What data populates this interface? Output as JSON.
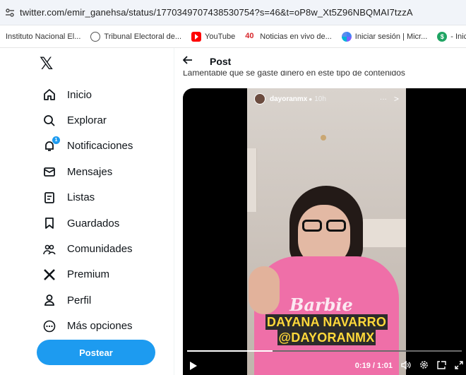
{
  "browser": {
    "url": "twitter.com/emir_ganehsa/status/1770349707438530754?s=46&t=oP8w_Xt5Z96NBQMAI7tzzA",
    "bookmarks": [
      {
        "label": "Instituto Nacional El...",
        "icon": "none"
      },
      {
        "label": "Tribunal Electoral de...",
        "icon": "globe-icon"
      },
      {
        "label": "YouTube",
        "icon": "youtube-icon"
      },
      {
        "label": "Noticias en vivo de...",
        "icon": "40-icon"
      },
      {
        "label": "Iniciar sesión | Micr...",
        "icon": "microsoft-icon"
      },
      {
        "label": "- Inicio",
        "icon": "s-icon"
      }
    ]
  },
  "sidebar": {
    "logo": "𝕏",
    "items": [
      {
        "label": "Inicio",
        "icon": "home-icon"
      },
      {
        "label": "Explorar",
        "icon": "search-icon"
      },
      {
        "label": "Notificaciones",
        "icon": "bell-icon",
        "badge": "1"
      },
      {
        "label": "Mensajes",
        "icon": "mail-icon"
      },
      {
        "label": "Listas",
        "icon": "list-icon"
      },
      {
        "label": "Guardados",
        "icon": "bookmark-icon"
      },
      {
        "label": "Comunidades",
        "icon": "communities-icon"
      },
      {
        "label": "Premium",
        "icon": "x-icon"
      },
      {
        "label": "Perfil",
        "icon": "profile-icon"
      },
      {
        "label": "Más opciones",
        "icon": "more-icon"
      }
    ],
    "post_button": "Postear"
  },
  "main": {
    "header_title": "Post",
    "tweet_text": "Lamentable que se gaste dinero en este tipo de contenidos",
    "video": {
      "story_user": "dayoranmx",
      "story_time": "10h",
      "hoodie_text": "Barbie",
      "caption_line1": "DAYANA NAVARRO",
      "caption_line2": "@DAYORANMX",
      "time_display": "0:19 / 1:01",
      "progress": 0.31
    }
  },
  "colors": {
    "accent": "#1d9bf0",
    "caption_yellow": "#ffd83a",
    "hoodie_pink": "#ef6fa8"
  }
}
